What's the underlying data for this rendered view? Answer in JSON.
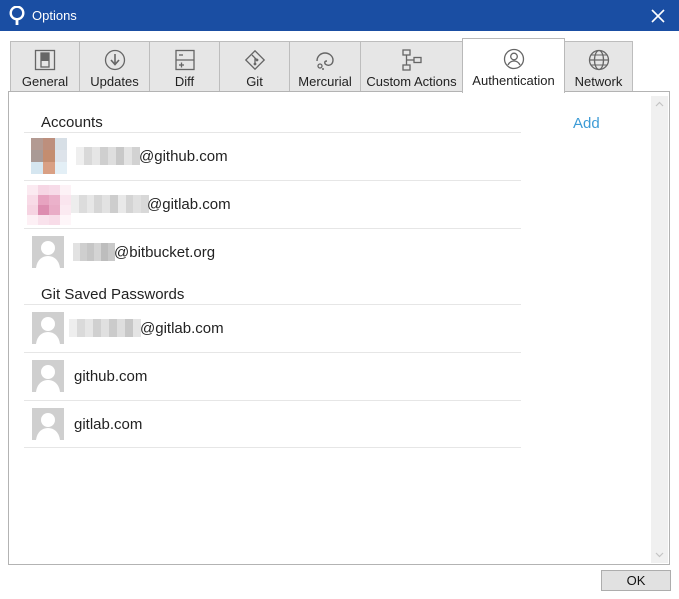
{
  "window": {
    "title": "Options",
    "accent": "#1a4ea3"
  },
  "tabs": [
    {
      "label": "General",
      "icon": "switch-icon"
    },
    {
      "label": "Updates",
      "icon": "download-circle-icon"
    },
    {
      "label": "Diff",
      "icon": "diff-icon"
    },
    {
      "label": "Git",
      "icon": "git-icon"
    },
    {
      "label": "Mercurial",
      "icon": "mercurial-icon"
    },
    {
      "label": "Custom Actions",
      "icon": "flowchart-icon"
    },
    {
      "label": "Authentication",
      "icon": "user-circle-icon",
      "selected": true
    },
    {
      "label": "Network",
      "icon": "globe-icon"
    }
  ],
  "accounts": {
    "header": "Accounts",
    "add_label": "Add",
    "add_color": "#3c9bd6",
    "items": [
      {
        "label": "@github.com"
      },
      {
        "label": "@gitlab.com"
      },
      {
        "label": "@bitbucket.org"
      }
    ]
  },
  "git_saved": {
    "header": "Git Saved Passwords",
    "items": [
      {
        "label": "@gitlab.com"
      },
      {
        "label": "github.com"
      },
      {
        "label": "gitlab.com"
      }
    ]
  },
  "footer": {
    "ok_label": "OK"
  }
}
